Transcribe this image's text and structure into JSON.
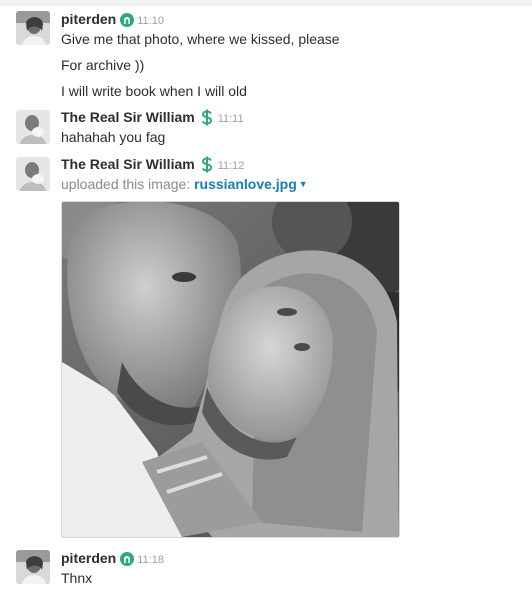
{
  "messages": [
    {
      "author": "piterden",
      "badge": "owner-icon",
      "time": "11:10",
      "lines": [
        "Give me that photo, where we kissed, please",
        "For archive ))",
        "I will write book when I will old"
      ]
    },
    {
      "author": "The Real Sir William",
      "badge": "dollar-icon",
      "time": "11:11",
      "lines": [
        "hahahah you fag"
      ]
    },
    {
      "author": "The Real Sir William",
      "badge": "dollar-icon",
      "time": "11:12",
      "upload_prefix": "uploaded this image:",
      "file_name": "russianlove.jpg",
      "image": "photo-of-two-men-kissing-bw"
    },
    {
      "author": "piterden",
      "badge": "owner-icon",
      "time": "11:18",
      "lines": [
        "Thnx"
      ]
    }
  ],
  "colors": {
    "badge_green": "#2bac76",
    "link_blue": "#1a7eb3",
    "timestamp_gray": "#9e9ea6",
    "text": "#2c2d30"
  }
}
